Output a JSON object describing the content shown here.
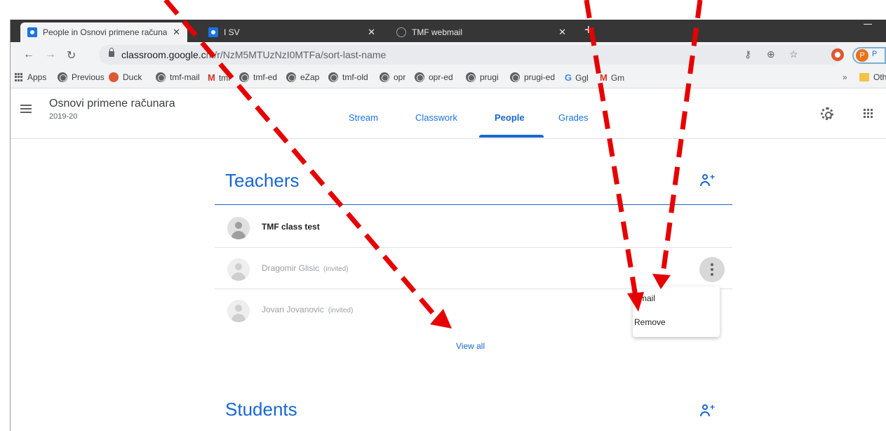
{
  "browser": {
    "tabs": [
      {
        "title": "People in Osnovi primene računa",
        "active": true
      },
      {
        "title": "I SV",
        "active": false
      },
      {
        "title": "TMF webmail",
        "active": false
      }
    ],
    "close_glyph": "✕",
    "new_tab_glyph": "+",
    "url_host": "classroom.google.c",
    "url_path": "m/r/NzM5MTUzNzI0MTFa/sort-last-name",
    "avatar_letter": "P",
    "avatar_text": "P",
    "bookmarks": [
      {
        "label": "Apps",
        "icon": "apps-grid-icon"
      },
      {
        "label": "Previous",
        "icon": "globe-icon"
      },
      {
        "label": "Duck",
        "icon": "duckduckgo-icon"
      },
      {
        "label": "tmf-mail",
        "icon": "globe-icon"
      },
      {
        "label": "tmf",
        "icon": "gmail-icon"
      },
      {
        "label": "tmf-ed",
        "icon": "globe-icon"
      },
      {
        "label": "eZap",
        "icon": "globe-icon"
      },
      {
        "label": "tmf-old",
        "icon": "globe-icon"
      },
      {
        "label": "opr",
        "icon": "globe-icon"
      },
      {
        "label": "opr-ed",
        "icon": "globe-icon"
      },
      {
        "label": "prugi",
        "icon": "globe-icon"
      },
      {
        "label": "prugi-ed",
        "icon": "globe-icon"
      },
      {
        "label": "Ggl",
        "icon": "google-icon"
      },
      {
        "label": "Gm",
        "icon": "gmail-icon"
      }
    ],
    "bookmarks_overflow": "»",
    "other_bookmarks": "Othe"
  },
  "classroom": {
    "class_title": "Osnovi primene računara",
    "class_year": "2019-20",
    "nav": [
      "Stream",
      "Classwork",
      "People",
      "Grades"
    ],
    "active_nav": "People"
  },
  "teachers": {
    "heading": "Teachers",
    "people": [
      {
        "name": "TMF class test",
        "status": ""
      },
      {
        "name": "Dragomir Glisic",
        "status": "(invited)"
      },
      {
        "name": "Jovan Jovanovic",
        "status": "(invited)"
      }
    ],
    "view_all": "View all"
  },
  "context_menu": {
    "items": [
      "Email",
      "Remove"
    ]
  },
  "students": {
    "heading": "Students"
  },
  "colors": {
    "accent": "#1967d2",
    "annotation_arrow": "#e60000"
  }
}
